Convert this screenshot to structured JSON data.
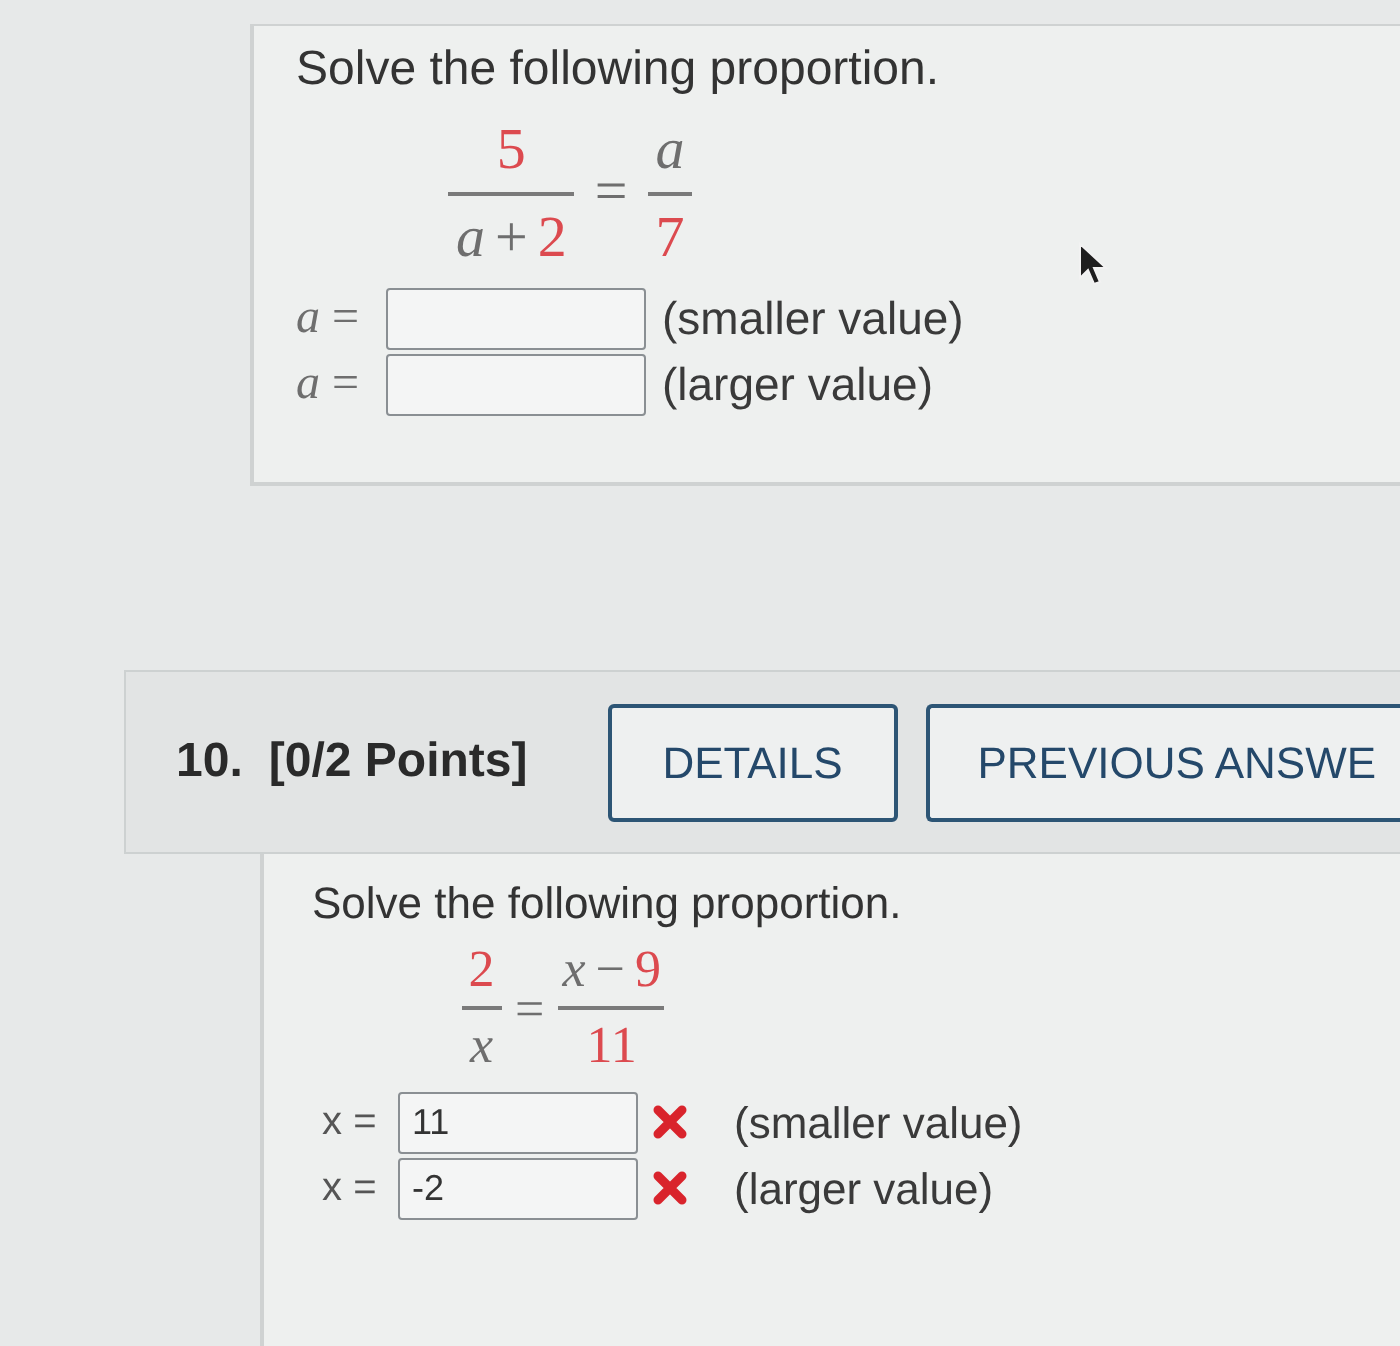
{
  "questions": [
    {
      "prompt": "Solve the following proportion.",
      "equation": {
        "lhs": {
          "numerator": [
            {
              "kind": "number",
              "text": "5"
            }
          ],
          "denominator": [
            {
              "kind": "variable",
              "text": "a"
            },
            {
              "kind": "operator",
              "text": "+"
            },
            {
              "kind": "number",
              "text": "2"
            }
          ]
        },
        "relation": "=",
        "rhs": {
          "numerator": [
            {
              "kind": "variable",
              "text": "a"
            }
          ],
          "denominator": [
            {
              "kind": "number",
              "text": "7"
            }
          ]
        }
      },
      "answers": [
        {
          "variable": {
            "kind": "math",
            "text": "a"
          },
          "relation": "=",
          "hint": "(smaller value)"
        },
        {
          "variable": {
            "kind": "math",
            "text": "a"
          },
          "relation": "=",
          "hint": "(larger value)"
        }
      ]
    },
    {
      "number": "10.",
      "points": "[0/2 Points]",
      "buttons": [
        {
          "label": "DETAILS"
        },
        {
          "label": "PREVIOUS ANSWE"
        }
      ],
      "prompt": "Solve the following proportion.",
      "equation": {
        "lhs": {
          "numerator": [
            {
              "kind": "number",
              "text": "2"
            }
          ],
          "denominator": [
            {
              "kind": "variable",
              "text": "x"
            }
          ]
        },
        "relation": "=",
        "rhs": {
          "numerator": [
            {
              "kind": "variable",
              "text": "x"
            },
            {
              "kind": "operator",
              "text": "−"
            },
            {
              "kind": "number",
              "text": "9"
            }
          ],
          "denominator": [
            {
              "kind": "number",
              "text": "11"
            }
          ]
        }
      },
      "answers": [
        {
          "variable": {
            "kind": "plain",
            "text": "x"
          },
          "relation": "=",
          "value": "11",
          "correct": false,
          "hint": "(smaller value)"
        },
        {
          "variable": {
            "kind": "plain",
            "text": "x"
          },
          "relation": "=",
          "value": "-2",
          "correct": false,
          "hint": "(larger value)"
        }
      ]
    }
  ]
}
